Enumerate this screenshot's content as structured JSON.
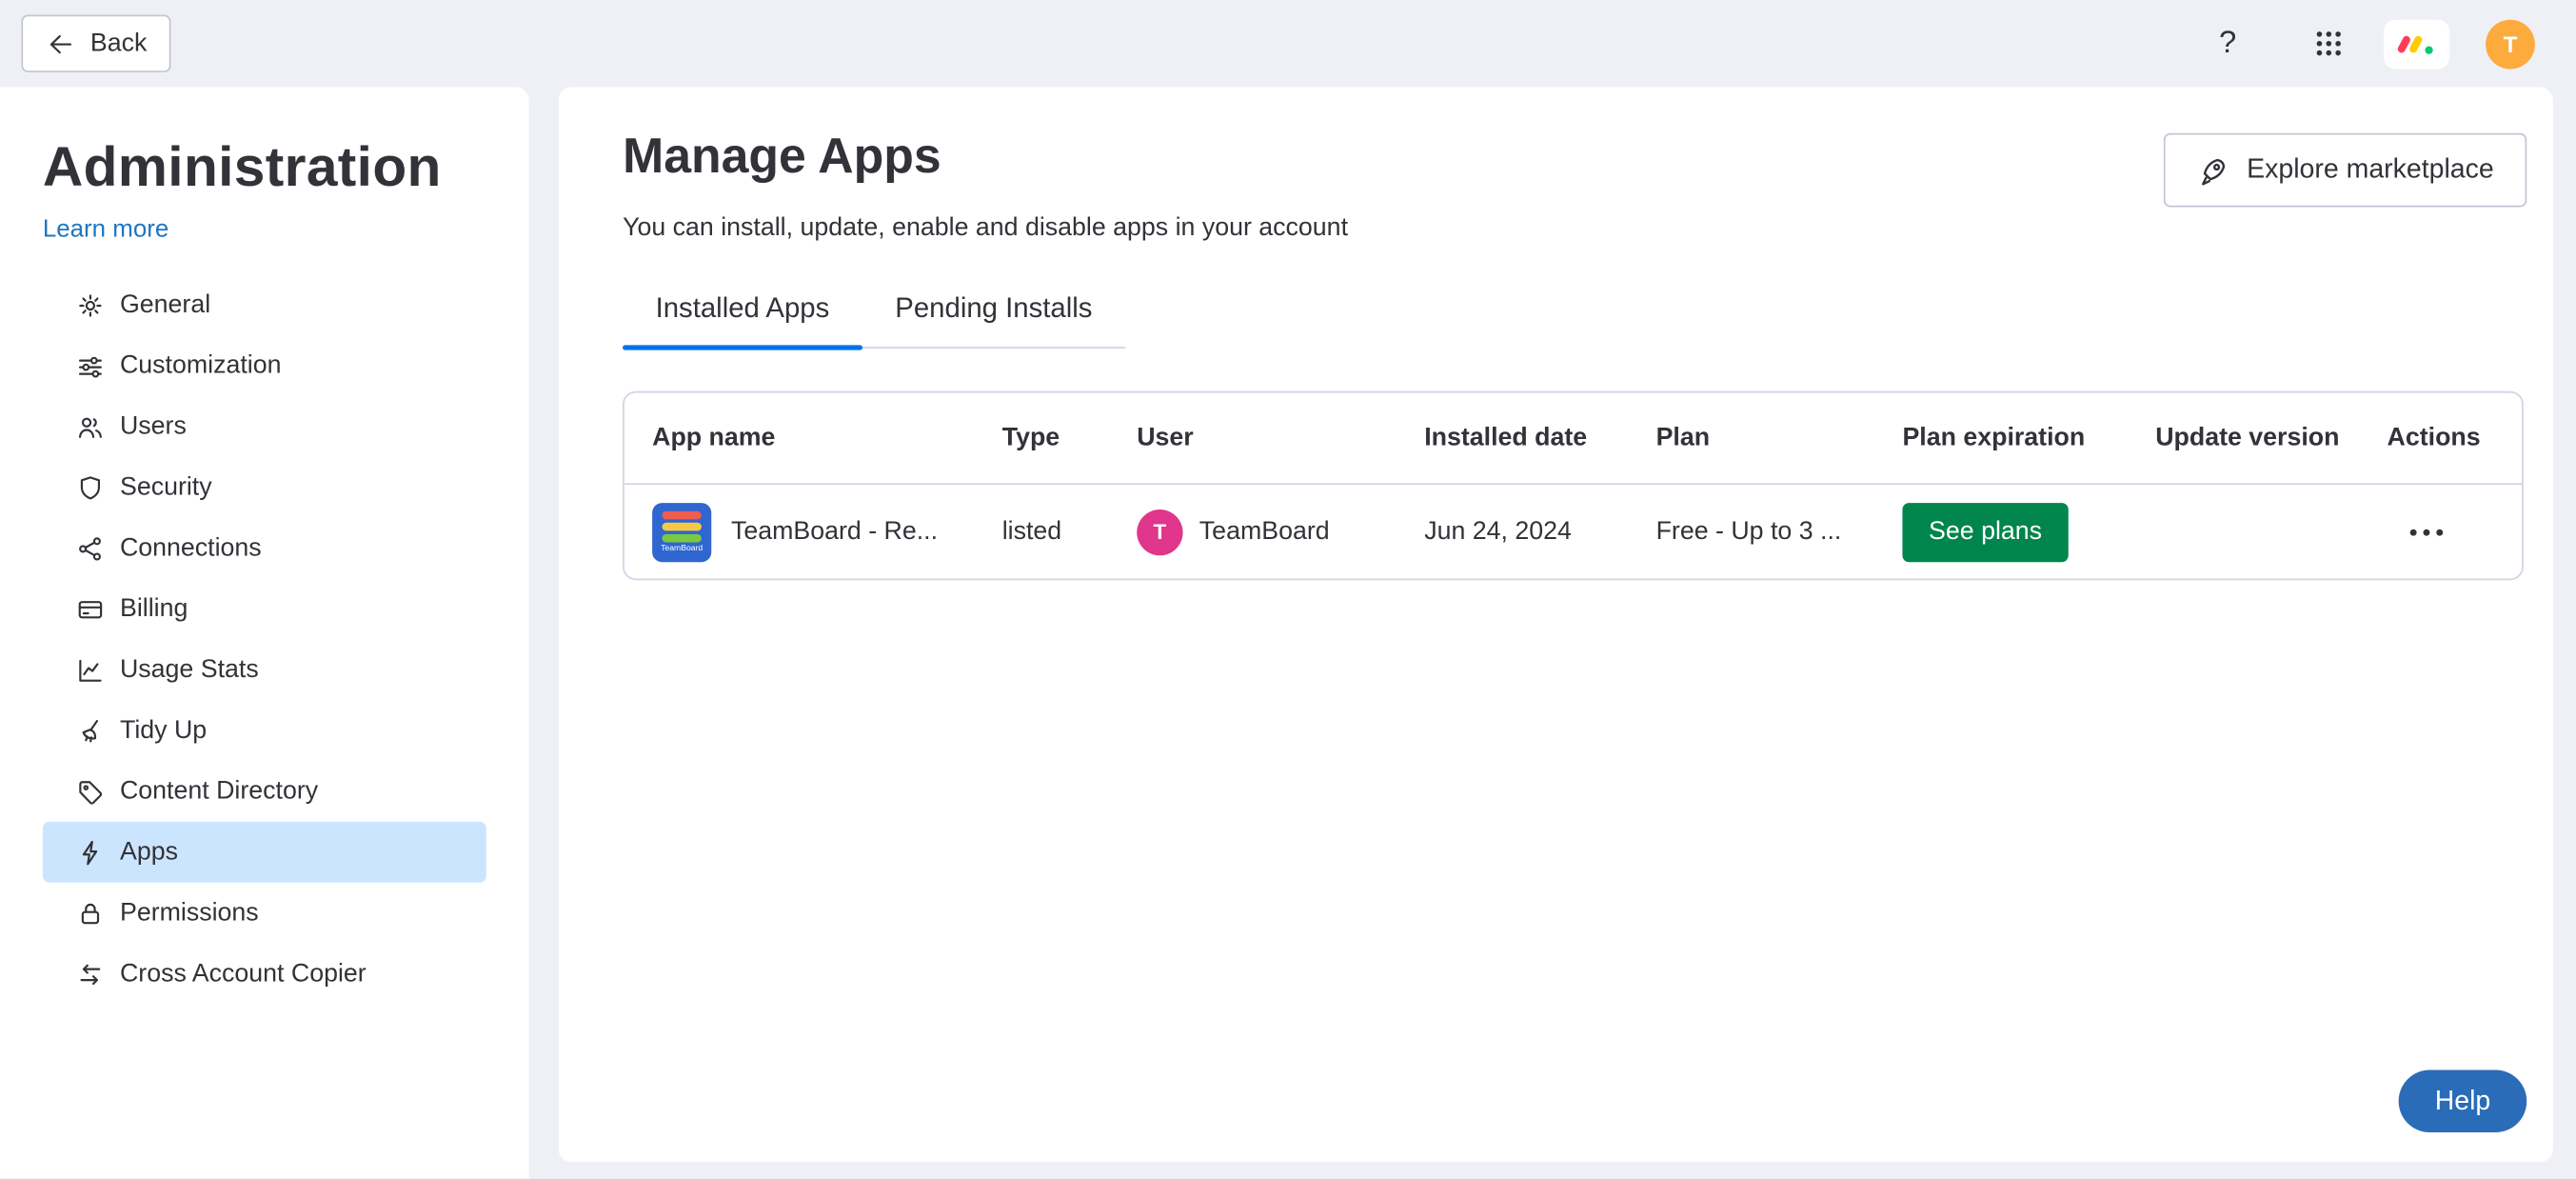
{
  "topbar": {
    "back_label": "Back",
    "question_icon": "?",
    "avatar_initial": "T",
    "icons": [
      "back-arrow-icon",
      "question-help-icon",
      "apps-grid-icon",
      "monday-logo-icon",
      "user-avatar"
    ]
  },
  "sidebar": {
    "title": "Administration",
    "learn_more_label": "Learn more",
    "items": [
      {
        "label": "General",
        "icon": "gear-icon",
        "selected": false
      },
      {
        "label": "Customization",
        "icon": "sliders-icon",
        "selected": false
      },
      {
        "label": "Users",
        "icon": "users-icon",
        "selected": false
      },
      {
        "label": "Security",
        "icon": "shield-icon",
        "selected": false
      },
      {
        "label": "Connections",
        "icon": "connections-icon",
        "selected": false
      },
      {
        "label": "Billing",
        "icon": "credit-card-icon",
        "selected": false
      },
      {
        "label": "Usage Stats",
        "icon": "chart-icon",
        "selected": false
      },
      {
        "label": "Tidy Up",
        "icon": "broom-icon",
        "selected": false
      },
      {
        "label": "Content Directory",
        "icon": "tag-icon",
        "selected": false
      },
      {
        "label": "Apps",
        "icon": "lightning-icon",
        "selected": true
      },
      {
        "label": "Permissions",
        "icon": "lock-icon",
        "selected": false
      },
      {
        "label": "Cross Account Copier",
        "icon": "transfer-arrows-icon",
        "selected": false
      }
    ]
  },
  "main": {
    "title": "Manage Apps",
    "subtitle": "You can install, update, enable and disable apps in your account",
    "explore_button_label": "Explore marketplace",
    "explore_button_icon": "rocket-icon",
    "tabs": [
      {
        "label": "Installed Apps",
        "active": true
      },
      {
        "label": "Pending Installs",
        "active": false
      }
    ],
    "table": {
      "columns": [
        "App name",
        "Type",
        "User",
        "Installed date",
        "Plan",
        "Plan expiration",
        "Update version",
        "Actions"
      ],
      "rows": [
        {
          "app_name": "TeamBoard - Re...",
          "app_logo_text": "TeamBoard",
          "type": "listed",
          "user_name": "TeamBoard",
          "user_initial": "T",
          "installed_date": "Jun 24, 2024",
          "plan": "Free - Up to 3 ...",
          "plan_expiration_action": "See plans",
          "update_version": "",
          "actions_icon": "more-actions-icon"
        }
      ]
    }
  },
  "help_button_label": "Help",
  "colors": {
    "accent_blue": "#0073ea",
    "link_blue": "#1f76c2",
    "selected_item_bg": "#cce5ff",
    "see_plans_green": "#00854d",
    "help_button_blue": "#2b6cb8",
    "topbar_avatar_yellow": "#fdab3d",
    "user_avatar_pink": "#e0368c",
    "app_logo_blue": "#2f66d0",
    "page_background": "#eef0f5"
  }
}
